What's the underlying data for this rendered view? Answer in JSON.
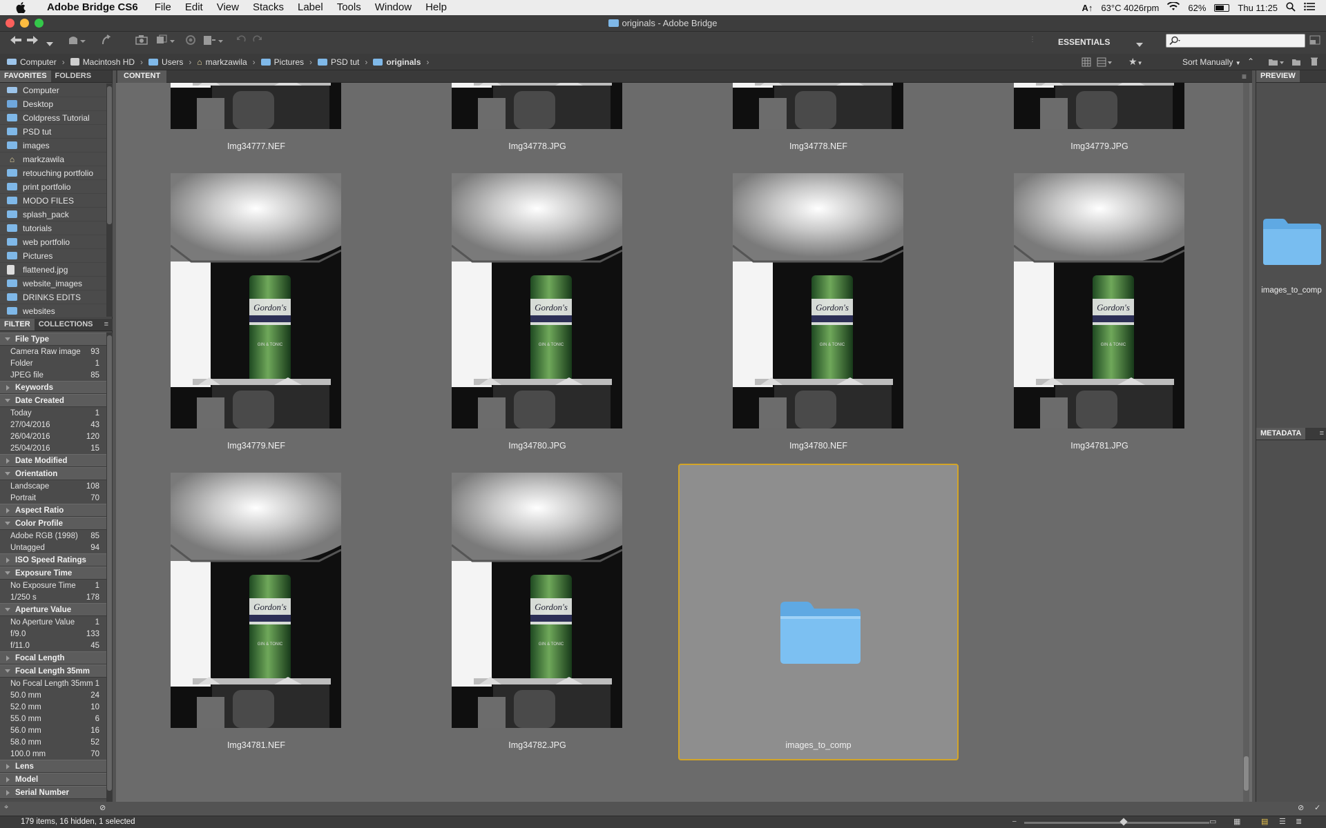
{
  "menubar": {
    "app_name": "Adobe Bridge CS6",
    "menus": [
      "File",
      "Edit",
      "View",
      "Stacks",
      "Label",
      "Tools",
      "Window",
      "Help"
    ],
    "status_temp": "63°C 4026rpm",
    "battery": "62%",
    "clock": "Thu 11:25"
  },
  "window": {
    "title": "originals - Adobe Bridge"
  },
  "toolbar": {
    "workspace": "ESSENTIALS",
    "search_placeholder": ""
  },
  "path": {
    "crumbs": [
      "Computer",
      "Macintosh HD",
      "Users",
      "markzawila",
      "Pictures",
      "PSD tut",
      "originals"
    ],
    "sort_label": "Sort Manually"
  },
  "left_panel": {
    "tabs": [
      "FAVORITES",
      "FOLDERS"
    ],
    "favorites": [
      "Computer",
      "Desktop",
      "Coldpress Tutorial",
      "PSD tut",
      "images",
      "markzawila",
      "retouching portfolio",
      "print portfolio",
      "MODO FILES",
      "splash_pack",
      "tutorials",
      "web portfolio",
      "Pictures",
      "flattened.jpg",
      "website_images",
      "DRINKS EDITS",
      "websites"
    ],
    "filter_tabs": [
      "FILTER",
      "COLLECTIONS"
    ],
    "filters": [
      {
        "name": "File Type",
        "open": true,
        "rows": [
          [
            "Camera Raw image",
            "93"
          ],
          [
            "Folder",
            "1"
          ],
          [
            "JPEG file",
            "85"
          ]
        ]
      },
      {
        "name": "Keywords",
        "open": false,
        "rows": []
      },
      {
        "name": "Date Created",
        "open": true,
        "rows": [
          [
            "Today",
            "1"
          ],
          [
            "27/04/2016",
            "43"
          ],
          [
            "26/04/2016",
            "120"
          ],
          [
            "25/04/2016",
            "15"
          ]
        ]
      },
      {
        "name": "Date Modified",
        "open": false,
        "rows": []
      },
      {
        "name": "Orientation",
        "open": true,
        "rows": [
          [
            "Landscape",
            "108"
          ],
          [
            "Portrait",
            "70"
          ]
        ]
      },
      {
        "name": "Aspect Ratio",
        "open": false,
        "rows": []
      },
      {
        "name": "Color Profile",
        "open": true,
        "rows": [
          [
            "Adobe RGB (1998)",
            "85"
          ],
          [
            "Untagged",
            "94"
          ]
        ]
      },
      {
        "name": "ISO Speed Ratings",
        "open": false,
        "rows": []
      },
      {
        "name": "Exposure Time",
        "open": true,
        "rows": [
          [
            "No Exposure Time",
            "1"
          ],
          [
            "1/250 s",
            "178"
          ]
        ]
      },
      {
        "name": "Aperture Value",
        "open": true,
        "rows": [
          [
            "No Aperture Value",
            "1"
          ],
          [
            "f/9.0",
            "133"
          ],
          [
            "f/11.0",
            "45"
          ]
        ]
      },
      {
        "name": "Focal Length",
        "open": false,
        "rows": []
      },
      {
        "name": "Focal Length 35mm",
        "open": true,
        "rows": [
          [
            "No Focal Length 35mm",
            "1"
          ],
          [
            "50.0 mm",
            "24"
          ],
          [
            "52.0 mm",
            "10"
          ],
          [
            "55.0 mm",
            "6"
          ],
          [
            "56.0 mm",
            "16"
          ],
          [
            "58.0 mm",
            "52"
          ],
          [
            "100.0 mm",
            "70"
          ]
        ]
      },
      {
        "name": "Lens",
        "open": false,
        "rows": []
      },
      {
        "name": "Model",
        "open": false,
        "rows": []
      },
      {
        "name": "Serial Number",
        "open": false,
        "rows": []
      }
    ]
  },
  "content": {
    "tab": "CONTENT",
    "items": [
      {
        "name": "Img34777.NEF",
        "kind": "image",
        "partial": true
      },
      {
        "name": "Img34778.JPG",
        "kind": "image",
        "partial": true
      },
      {
        "name": "Img34778.NEF",
        "kind": "image",
        "partial": true
      },
      {
        "name": "Img34779.JPG",
        "kind": "image",
        "partial": true
      },
      {
        "name": "Img34779.NEF",
        "kind": "image"
      },
      {
        "name": "Img34780.JPG",
        "kind": "image"
      },
      {
        "name": "Img34780.NEF",
        "kind": "image"
      },
      {
        "name": "Img34781.JPG",
        "kind": "image"
      },
      {
        "name": "Img34781.NEF",
        "kind": "image"
      },
      {
        "name": "Img34782.JPG",
        "kind": "image"
      },
      {
        "name": "images_to_comp",
        "kind": "folder",
        "selected": true
      }
    ],
    "can_label": "Gordon's",
    "can_sub": "GIN & TONIC"
  },
  "right_panel": {
    "preview_tab": "PREVIEW",
    "preview_item": "images_to_comp",
    "metadata_tab": "METADATA"
  },
  "status": {
    "text": "179 items, 16 hidden, 1 selected"
  },
  "colors": {
    "accent_selection": "#d3a527",
    "folder": "#7fb8e8"
  }
}
